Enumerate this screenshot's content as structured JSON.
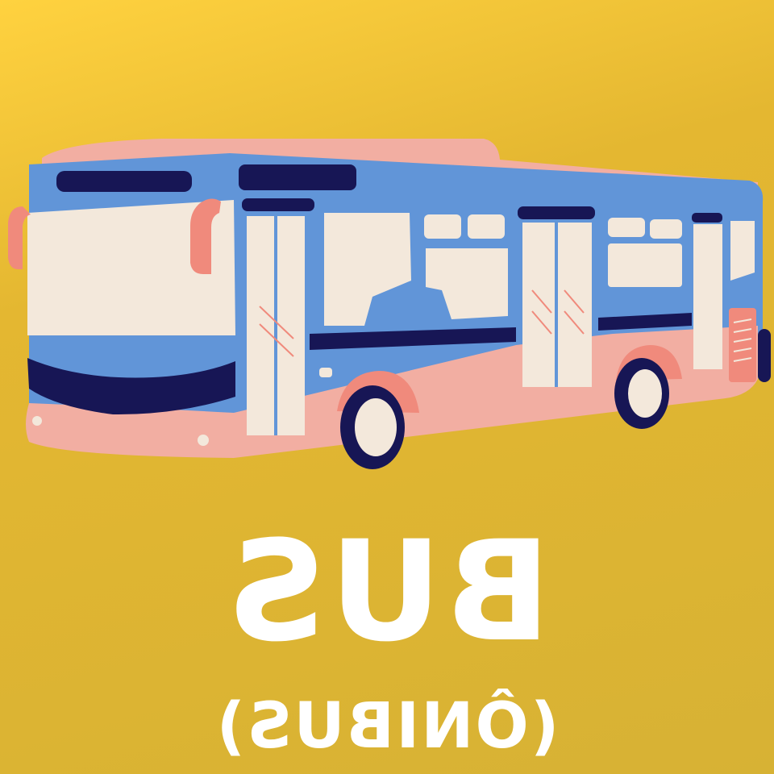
{
  "illustration": {
    "subject": "bus",
    "colors": {
      "background": "#dbb534",
      "bus_body_blue": "#6195d8",
      "bus_body_pink": "#f2aea2",
      "windows": "#f3e8db",
      "dark_accent": "#171655",
      "mirror_pink": "#f08a7c"
    }
  },
  "title": "BUS",
  "subtitle": "(ÔNIBUS)"
}
